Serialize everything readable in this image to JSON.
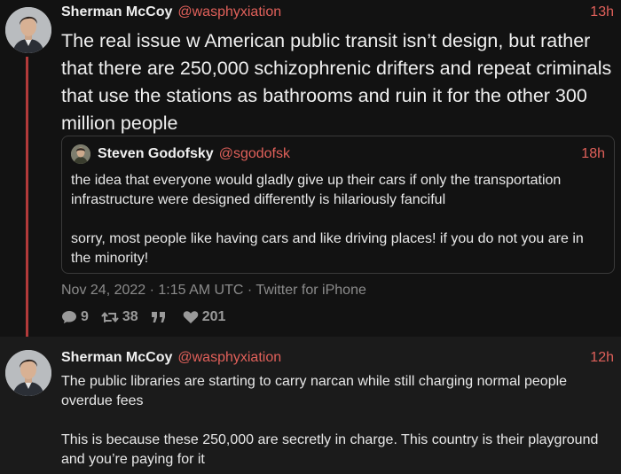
{
  "tweets": [
    {
      "author_name": "Sherman McCoy",
      "author_handle": "@wasphyxiation",
      "time": "13h",
      "text": "The real issue w American public transit isn’t design, but rather that there are 250,000 schizophrenic drifters and repeat criminals that use the stations as bathrooms and ruin it for the other 300 million people",
      "quote": {
        "author_name": "Steven Godofsky",
        "author_handle": "@sgodofsk",
        "time": "18h",
        "paragraphs": [
          "the idea that everyone would gladly give up their cars if only the transportation infrastructure were designed differently is hilariously fanciful",
          "sorry, most people like having cars and like driving places! if you do not you are in the minority!"
        ]
      },
      "meta": "Nov 24, 2022 · 1:15 AM UTC · Twitter for iPhone",
      "stats": {
        "replies": "9",
        "retweets": "38",
        "quotes": "",
        "likes": "201"
      }
    },
    {
      "author_name": "Sherman McCoy",
      "author_handle": "@wasphyxiation",
      "time": "12h",
      "paragraphs": [
        "The public libraries are starting to carry narcan while still charging normal people overdue fees",
        "This is because these 250,000 are secretly in charge. This country is their playground and you’re paying for it"
      ]
    }
  ],
  "icons": {
    "reply": "comment-icon",
    "retweet": "retweet-icon",
    "quote": "quote-icon",
    "like": "heart-icon"
  },
  "colors": {
    "accent": "#e0605a",
    "thread_line": "#b23a3a",
    "background": "#121212"
  }
}
